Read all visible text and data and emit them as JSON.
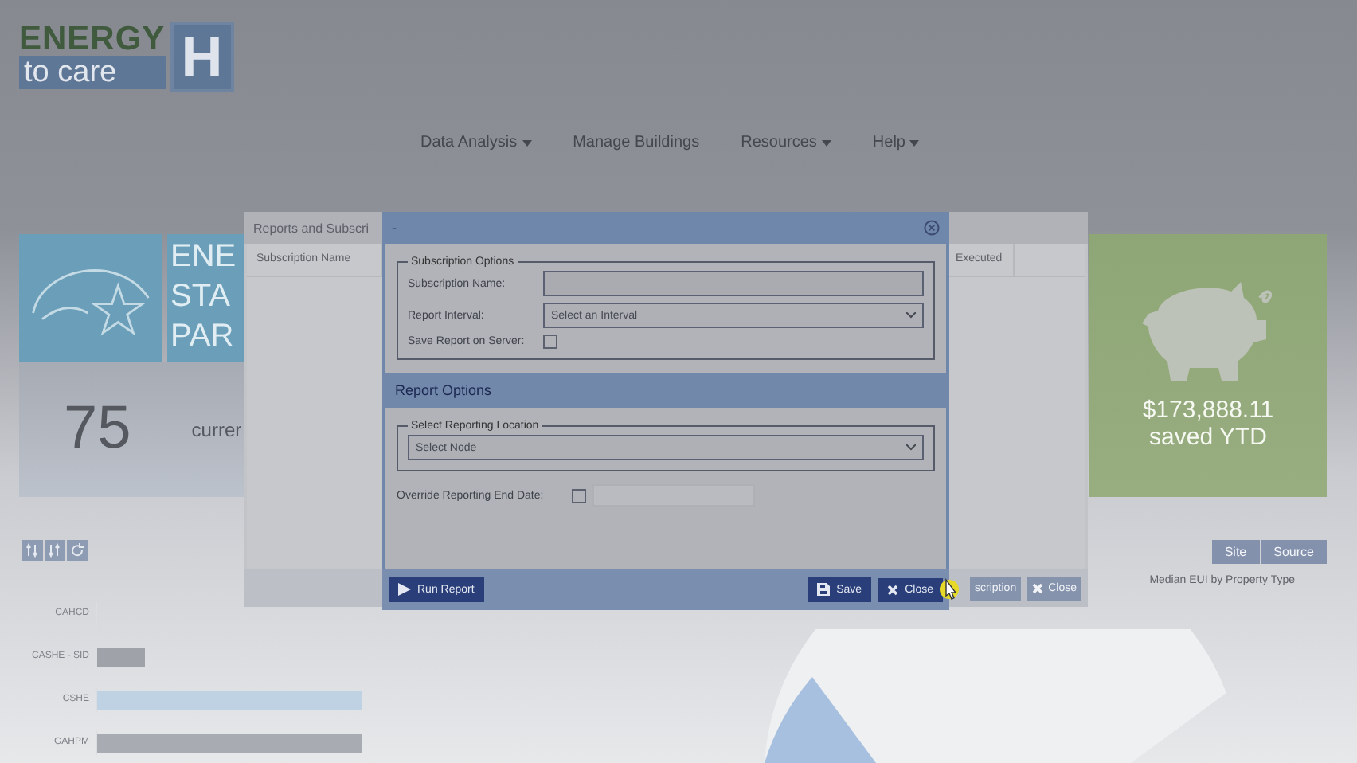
{
  "header": {
    "logo": {
      "word_top": "ENERGY",
      "word_bottom": "to care",
      "badge": "H"
    }
  },
  "nav": [
    {
      "label": "Data Analysis",
      "dropdown": true
    },
    {
      "label": "Manage Buildings",
      "dropdown": false
    },
    {
      "label": "Resources",
      "dropdown": true
    },
    {
      "label": "Help",
      "dropdown": true
    }
  ],
  "energy_star_card": {
    "lines": [
      "ENE",
      "STA",
      "PAR"
    ],
    "score": "75",
    "caption": "currer"
  },
  "savings_card": {
    "amount": "$173,888.11",
    "caption": "saved YTD"
  },
  "eui_chart": {
    "toggle": [
      "Site",
      "Source"
    ],
    "title": "Median EUI by Property Type",
    "categories": [
      "CAHCD",
      "CASHE - SID",
      "CSHE",
      "GAHPM"
    ]
  },
  "reports_dialog": {
    "title": "Reports and Subscri",
    "columns": [
      "Subscription Name",
      "Executed"
    ],
    "buttons": [
      {
        "label": "scription",
        "kind": "plain"
      },
      {
        "label": "Close",
        "kind": "close"
      }
    ]
  },
  "subscription_dialog": {
    "title": "-",
    "subscription_options": {
      "legend": "Subscription Options",
      "name_label": "Subscription Name:",
      "interval_label": "Report Interval:",
      "interval_placeholder": "Select an Interval",
      "save_label": "Save Report on Server:",
      "save_checked": false
    },
    "report_options": {
      "heading": "Report Options",
      "location_legend": "Select Reporting Location",
      "node_placeholder": "Select Node",
      "override_label": "Override Reporting End Date:",
      "override_checked": false
    },
    "buttons": [
      {
        "label": "Run Report",
        "kind": "play"
      },
      {
        "label": "Save",
        "kind": "save"
      },
      {
        "label": "Close",
        "kind": "close"
      }
    ]
  }
}
